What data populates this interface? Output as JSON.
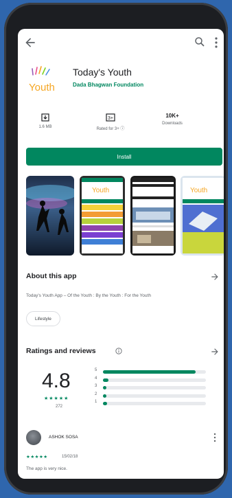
{
  "app": {
    "title": "Today's Youth",
    "developer": "Dada Bhagwan Foundation",
    "logo_text": "Youth"
  },
  "stats": [
    {
      "value": "",
      "label": "1.6 MB",
      "icon": "download-icon"
    },
    {
      "value": "",
      "label": "Rated for 3+ ⓘ",
      "icon": "rated-icon"
    },
    {
      "value": "10K+",
      "label": "Downloads",
      "icon": ""
    }
  ],
  "install_label": "Install",
  "about": {
    "title": "About this app",
    "text": "Today's Youth App – Of the Youth : By the Youth : For the Youth",
    "chip": "Lifestyle"
  },
  "ratings": {
    "title": "Ratings and reviews",
    "score": "4.8",
    "count": "272",
    "stars": "★★★★★",
    "distribution": [
      {
        "label": "5",
        "fraction": 0.9
      },
      {
        "label": "4",
        "fraction": 0.05
      },
      {
        "label": "3",
        "fraction": 0.03
      },
      {
        "label": "2",
        "fraction": 0.03
      },
      {
        "label": "1",
        "fraction": 0.04
      }
    ]
  },
  "review": {
    "name": "ASHOK SOSA",
    "stars": "★★★★★",
    "date": "15/02/18",
    "text": "The app is very nice."
  },
  "colors": {
    "accent": "#01875f",
    "background": "#2f66ad"
  }
}
